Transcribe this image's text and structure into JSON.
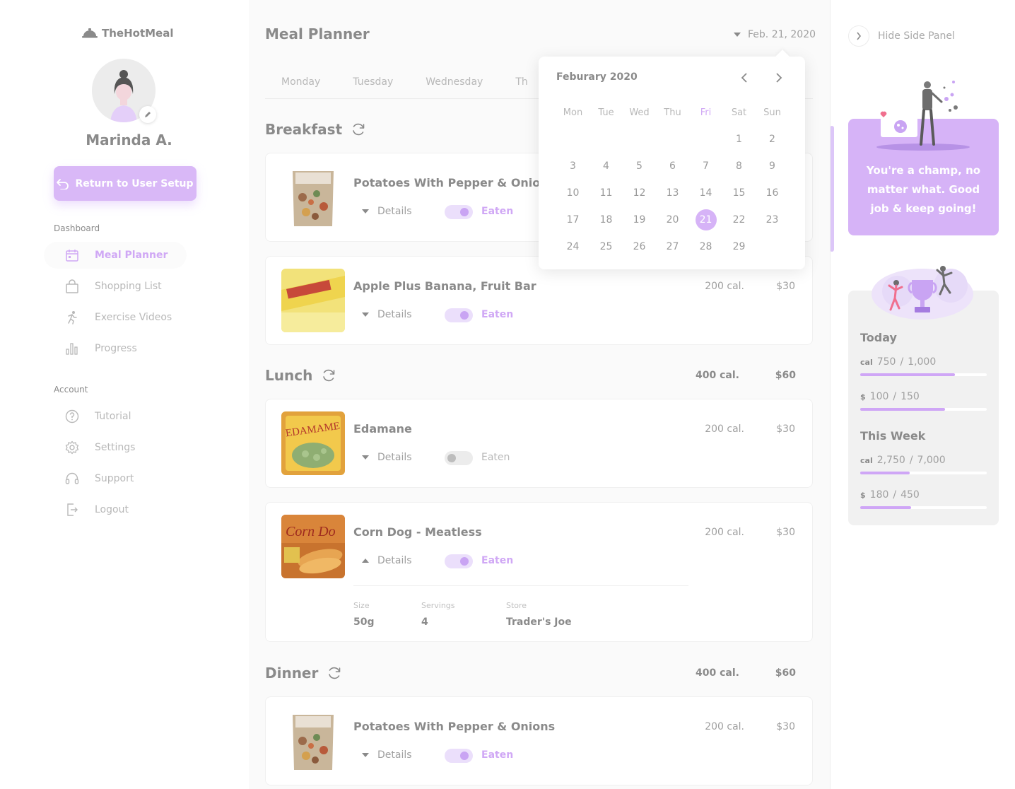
{
  "app": {
    "brand": "TheHotMeal",
    "user_name": "Marinda A.",
    "return_button": "Return to User Setup"
  },
  "sidebar": {
    "dashboard_label": "Dashboard",
    "account_label": "Account",
    "dashboard_items": [
      {
        "label": "Meal Planner",
        "icon": "calendar-icon",
        "active": true
      },
      {
        "label": "Shopping List",
        "icon": "shopping-bag-icon",
        "active": false
      },
      {
        "label": "Exercise Videos",
        "icon": "running-icon",
        "active": false
      },
      {
        "label": "Progress",
        "icon": "bar-chart-icon",
        "active": false
      }
    ],
    "account_items": [
      {
        "label": "Tutorial",
        "icon": "help-icon"
      },
      {
        "label": "Settings",
        "icon": "gear-icon"
      },
      {
        "label": "Support",
        "icon": "headset-icon"
      },
      {
        "label": "Logout",
        "icon": "logout-icon"
      }
    ]
  },
  "main": {
    "title": "Meal Planner",
    "date": "Feb. 21, 2020",
    "tabs": [
      "Monday",
      "Tuesday",
      "Wednesday",
      "Th"
    ],
    "meals": [
      {
        "name": "Breakfast",
        "items": [
          {
            "name": "Potatoes With Pepper & Onions",
            "cal": "",
            "price": "",
            "details_label": "Details",
            "eaten_label": "Eaten",
            "eaten": true
          },
          {
            "name": "Apple Plus Banana, Fruit Bar",
            "cal": "200 cal.",
            "price": "$30",
            "details_label": "Details",
            "eaten_label": "Eaten",
            "eaten": true
          }
        ]
      },
      {
        "name": "Lunch",
        "total_cal": "400 cal.",
        "total_price": "$60",
        "items": [
          {
            "name": "Edamane",
            "cal": "200 cal.",
            "price": "$30",
            "details_label": "Details",
            "eaten_label": "Eaten",
            "eaten": false
          },
          {
            "name": "Corn Dog - Meatless",
            "cal": "200 cal.",
            "price": "$30",
            "details_label": "Details",
            "eaten_label": "Eaten",
            "eaten": true,
            "details": {
              "size_label": "Size",
              "size": "50g",
              "servings_label": "Servings",
              "servings": "4",
              "store_label": "Store",
              "store": "Trader's Joe"
            }
          }
        ]
      },
      {
        "name": "Dinner",
        "total_cal": "400 cal.",
        "total_price": "$60",
        "items": [
          {
            "name": "Potatoes With Pepper & Onions",
            "cal": "200 cal.",
            "price": "$30",
            "details_label": "Details",
            "eaten_label": "Eaten",
            "eaten": true
          }
        ]
      }
    ]
  },
  "calendar": {
    "month": "Feburary 2020",
    "weekdays": [
      "Mon",
      "Tue",
      "Wed",
      "Thu",
      "Fri",
      "Sat",
      "Sun"
    ],
    "current_weekday": "Fri",
    "days": [
      "",
      "",
      "",
      "",
      "",
      "1",
      "2",
      "3",
      "4",
      "5",
      "6",
      "7",
      "8",
      "9",
      "10",
      "11",
      "12",
      "13",
      "14",
      "15",
      "16",
      "17",
      "18",
      "19",
      "20",
      "21",
      "22",
      "23",
      "24",
      "25",
      "26",
      "27",
      "28",
      "29",
      ""
    ],
    "selected": "21"
  },
  "side_panel": {
    "hide_label": "Hide Side Panel",
    "motivation": "You're a champ, no matter what. Good job & keep going!",
    "today_label": "Today",
    "week_label": "This Week",
    "today_cal_unit": "cal",
    "today_cal": "750",
    "today_cal_goal": "1,000",
    "today_cal_fraction": 0.75,
    "today_money_unit": "$",
    "today_money": "100",
    "today_money_goal": "150",
    "today_money_fraction": 0.67,
    "week_cal_unit": "cal",
    "week_cal": "2,750",
    "week_cal_goal": "7,000",
    "week_cal_fraction": 0.39,
    "week_money_unit": "$",
    "week_money": "180",
    "week_money_goal": "450",
    "week_money_fraction": 0.4,
    "separator": "/"
  },
  "colors": {
    "accent": "#d6b3f7",
    "accent_text": "#d0a8f5",
    "panel_bg": "#f1f1f1"
  }
}
